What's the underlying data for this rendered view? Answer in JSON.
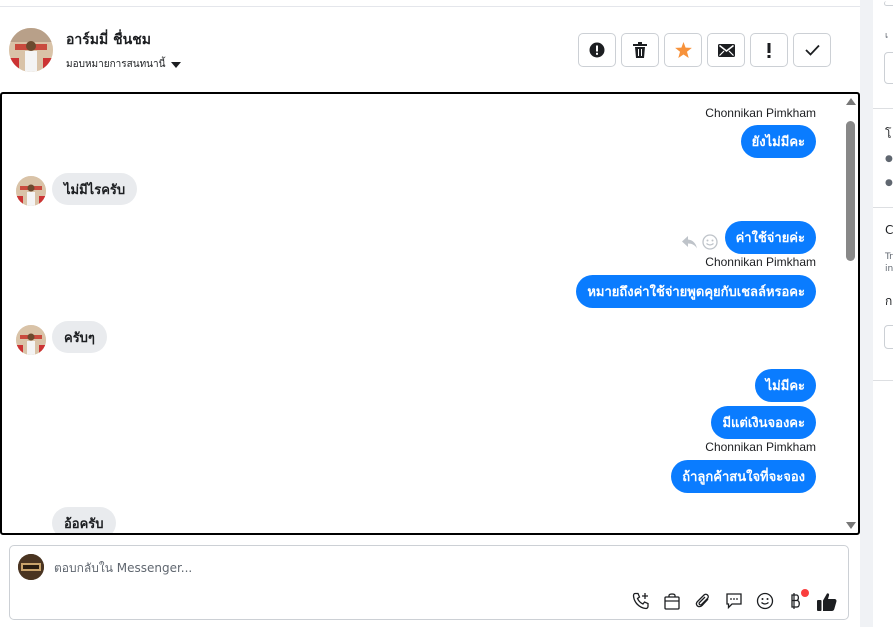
{
  "header": {
    "contact_name": "อาร์มมี่ ชื่นชม",
    "assign_label": "มอบหมายการสนทนานี้",
    "actions": [
      {
        "icon": "alert-circle-icon",
        "name": "spam-button"
      },
      {
        "icon": "trash-icon",
        "name": "delete-button"
      },
      {
        "icon": "star-icon",
        "name": "star-button"
      },
      {
        "icon": "envelope-icon",
        "name": "mark-unread-button"
      },
      {
        "icon": "exclamation-icon",
        "name": "follow-up-button"
      },
      {
        "icon": "check-icon",
        "name": "mark-done-button"
      }
    ],
    "star_color": "#f7923b"
  },
  "chat": {
    "accent": "#0a7cff",
    "messages": [
      {
        "sender": "Chonnikan Pimkham",
        "text": "ยังไม่มีคะ"
      },
      {
        "text": "ไม่มีไรครับ"
      },
      {
        "text": "ค่าใช้จ่ายค่ะ"
      },
      {
        "sender": "Chonnikan Pimkham",
        "text": "หมายถึงค่าใช้จ่ายพูดคุยกับเชลล์หรอคะ"
      },
      {
        "text": "ครับๆ"
      },
      {
        "text": "ไม่มีคะ"
      },
      {
        "text": "มีแต่เงินจองคะ"
      },
      {
        "sender": "Chonnikan Pimkham",
        "text": "ถ้าลูกค้าสนใจที่จะจอง"
      },
      {
        "text": "อ้อครับ"
      }
    ]
  },
  "composer": {
    "placeholder": "ตอบกลับใน Messenger...",
    "tools": [
      "phone-plus-icon",
      "shopping-bag-icon",
      "paperclip-icon",
      "saved-reply-icon",
      "emoji-icon",
      "baht-icon",
      "thumbs-up-icon"
    ]
  },
  "right_panel": {
    "c_label": "C",
    "tr_label": "Tr",
    "in_label": "in"
  }
}
